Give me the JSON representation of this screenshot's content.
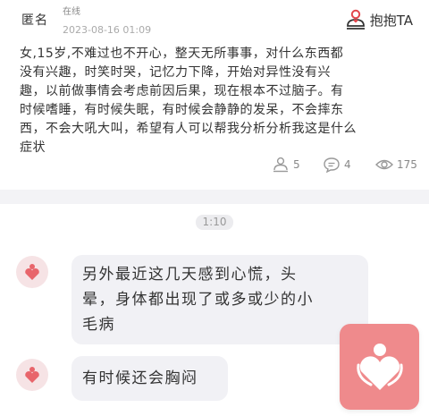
{
  "post": {
    "author": "匿名",
    "online_status": "在线",
    "timestamp": "2023-08-16 01:09",
    "hug_button_label": "抱抱TA",
    "content_lines": [
      "女,15岁,不难过也不开心，整天无所事事，对什么东西都",
      "没有兴趣，时笑时哭，记忆力下降，开始对异性没有兴",
      "趣，以前做事情会考虑前因后果，现在根本不过脑子。有",
      "时候嗜睡，有时候失眠，有时候会静静的发呆，不会摔东",
      "西，不会大吼大叫，希望有人可以帮我分析分析我这是什么",
      "症状"
    ],
    "stats": {
      "hugs": "5",
      "comments": "4",
      "views": "175"
    }
  },
  "chat": {
    "time_label": "1:10",
    "messages": [
      {
        "lines": [
          "另外最近这几天感到心慌，头",
          "晕，身体都出现了或多或少的小",
          "毛病"
        ]
      },
      {
        "lines": [
          "有时候还会胸闷"
        ]
      }
    ]
  },
  "colors": {
    "accent": "#e2464c",
    "floating_button": "#ef8a8c",
    "bubble_bg": "#f1f1f5",
    "avatar_bg": "#f6e3e5"
  },
  "icons": {
    "hug_button": "hug-person-icon",
    "stat_hugs": "hug-outline-icon",
    "stat_comments": "comment-bubble-icon",
    "stat_views": "eye-icon",
    "avatar": "heart-person-icon",
    "floating": "heart-hug-icon"
  }
}
